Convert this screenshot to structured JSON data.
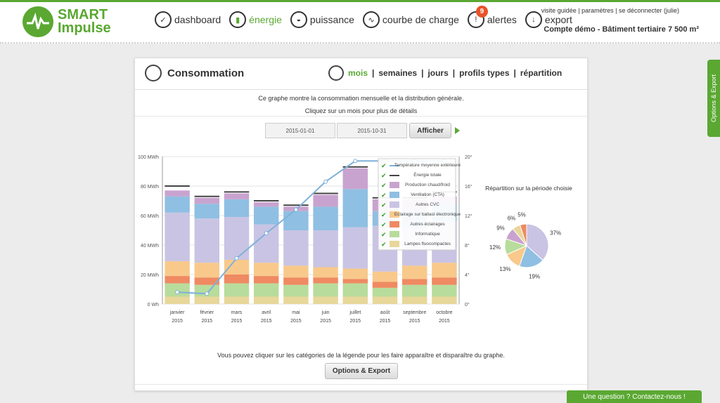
{
  "logo": {
    "line1": "SMART",
    "line2": "Impulse"
  },
  "nav": [
    {
      "label": "dashboard",
      "icon": "check-icon"
    },
    {
      "label": "énergie",
      "icon": "bar-chart-icon",
      "active": true
    },
    {
      "label": "puissance",
      "icon": "gauge-icon"
    },
    {
      "label": "courbe de charge",
      "icon": "pulse-icon"
    },
    {
      "label": "alertes",
      "icon": "alert-icon",
      "badge": "9"
    },
    {
      "label": "export",
      "icon": "download-icon"
    }
  ],
  "user": {
    "guided": "visite guidée",
    "settings": "paramètres",
    "logout": "se déconnecter (julie)"
  },
  "account": "Compte démo - Bâtiment tertiaire 7 500 m²",
  "card": {
    "title": "Consommation",
    "tabs": [
      "mois",
      "semaines",
      "jours",
      "profils types",
      "répartition"
    ],
    "desc1": "Ce graphe montre la consommation mensuelle et la distribution générale.",
    "desc2": "Cliquez sur un mois pour plus de détails",
    "date_from": "2015-01-01",
    "date_to": "2015-10-31",
    "show_button": "Afficher",
    "bottom_text": "Vous pouvez cliquer sur les catégories de la légende pour les faire apparaître et disparaître du graphe.",
    "options_button": "Options & Export"
  },
  "side_tab": "Options & Export",
  "contact": "Une question ? Contactez-nous !",
  "colors": {
    "brand": "#5aa832",
    "temp": "#7fb1d9"
  },
  "chart_data": [
    {
      "type": "bar",
      "stacked": true,
      "categories": [
        "janvier",
        "février",
        "mars",
        "avril",
        "mai",
        "juin",
        "juillet",
        "août",
        "septembre",
        "octobre"
      ],
      "category_year": "2015",
      "ylim": [
        0,
        100
      ],
      "y_ticks": [
        "0 Wh",
        "20 MWh",
        "40 MWh",
        "60 MWh",
        "80 MWh",
        "100 MWh"
      ],
      "y2lim": [
        0,
        20
      ],
      "y2_ticks": [
        "0°",
        "4°",
        "8°",
        "12°",
        "16°",
        "20°"
      ],
      "series": [
        {
          "name": "Lampes fluocompactes",
          "color": "#e8d79a",
          "values": [
            5,
            5,
            5,
            5,
            5,
            5,
            5,
            5,
            5,
            5
          ]
        },
        {
          "name": "Informatique",
          "color": "#b8dc9c",
          "values": [
            9,
            8,
            9,
            9,
            8,
            9,
            9,
            6,
            8,
            8
          ]
        },
        {
          "name": "Autres éclairages",
          "color": "#ef8a62",
          "values": [
            5,
            5,
            6,
            5,
            5,
            4,
            3,
            4,
            4,
            5
          ]
        },
        {
          "name": "Eclairage sur ballast électronique",
          "color": "#f8c98b",
          "values": [
            10,
            10,
            10,
            9,
            8,
            7,
            7,
            7,
            9,
            10
          ]
        },
        {
          "name": "Autres CVC",
          "color": "#c9c4e3",
          "values": [
            33,
            30,
            29,
            26,
            24,
            25,
            28,
            31,
            26,
            28
          ]
        },
        {
          "name": "Ventilation (CTA)",
          "color": "#8fbfe2",
          "values": [
            11,
            10,
            12,
            12,
            13,
            16,
            26,
            10,
            11,
            12
          ]
        },
        {
          "name": "Production chaud/froid",
          "color": "#c9a3cf",
          "values": [
            4,
            4,
            4,
            3,
            3,
            8,
            14,
            8,
            8,
            5
          ]
        },
        {
          "name": "Énergie totale",
          "color": "#444444",
          "values": [
            80,
            73,
            76,
            70,
            67,
            75,
            93,
            72,
            72,
            76
          ]
        }
      ],
      "line_series": {
        "name": "Température moyenne extérieure",
        "values": [
          1.6,
          1.4,
          6.2,
          9.6,
          12.8,
          16.6,
          19.4,
          19.4,
          19.4,
          19.4
        ]
      }
    },
    {
      "type": "pie",
      "title": "Répartition sur la période choisie",
      "slices": [
        {
          "label": "37%",
          "value": 37,
          "color": "#c9c4e3"
        },
        {
          "label": "19%",
          "value": 19,
          "color": "#8fbfe2"
        },
        {
          "label": "13%",
          "value": 13,
          "color": "#f8c98b"
        },
        {
          "label": "12%",
          "value": 12,
          "color": "#b8dc9c"
        },
        {
          "label": "9%",
          "value": 9,
          "color": "#c9a3cf"
        },
        {
          "label": "6%",
          "value": 6,
          "color": "#e8d79a"
        },
        {
          "label": "5%",
          "value": 5,
          "color": "#ef8a62"
        }
      ]
    }
  ]
}
